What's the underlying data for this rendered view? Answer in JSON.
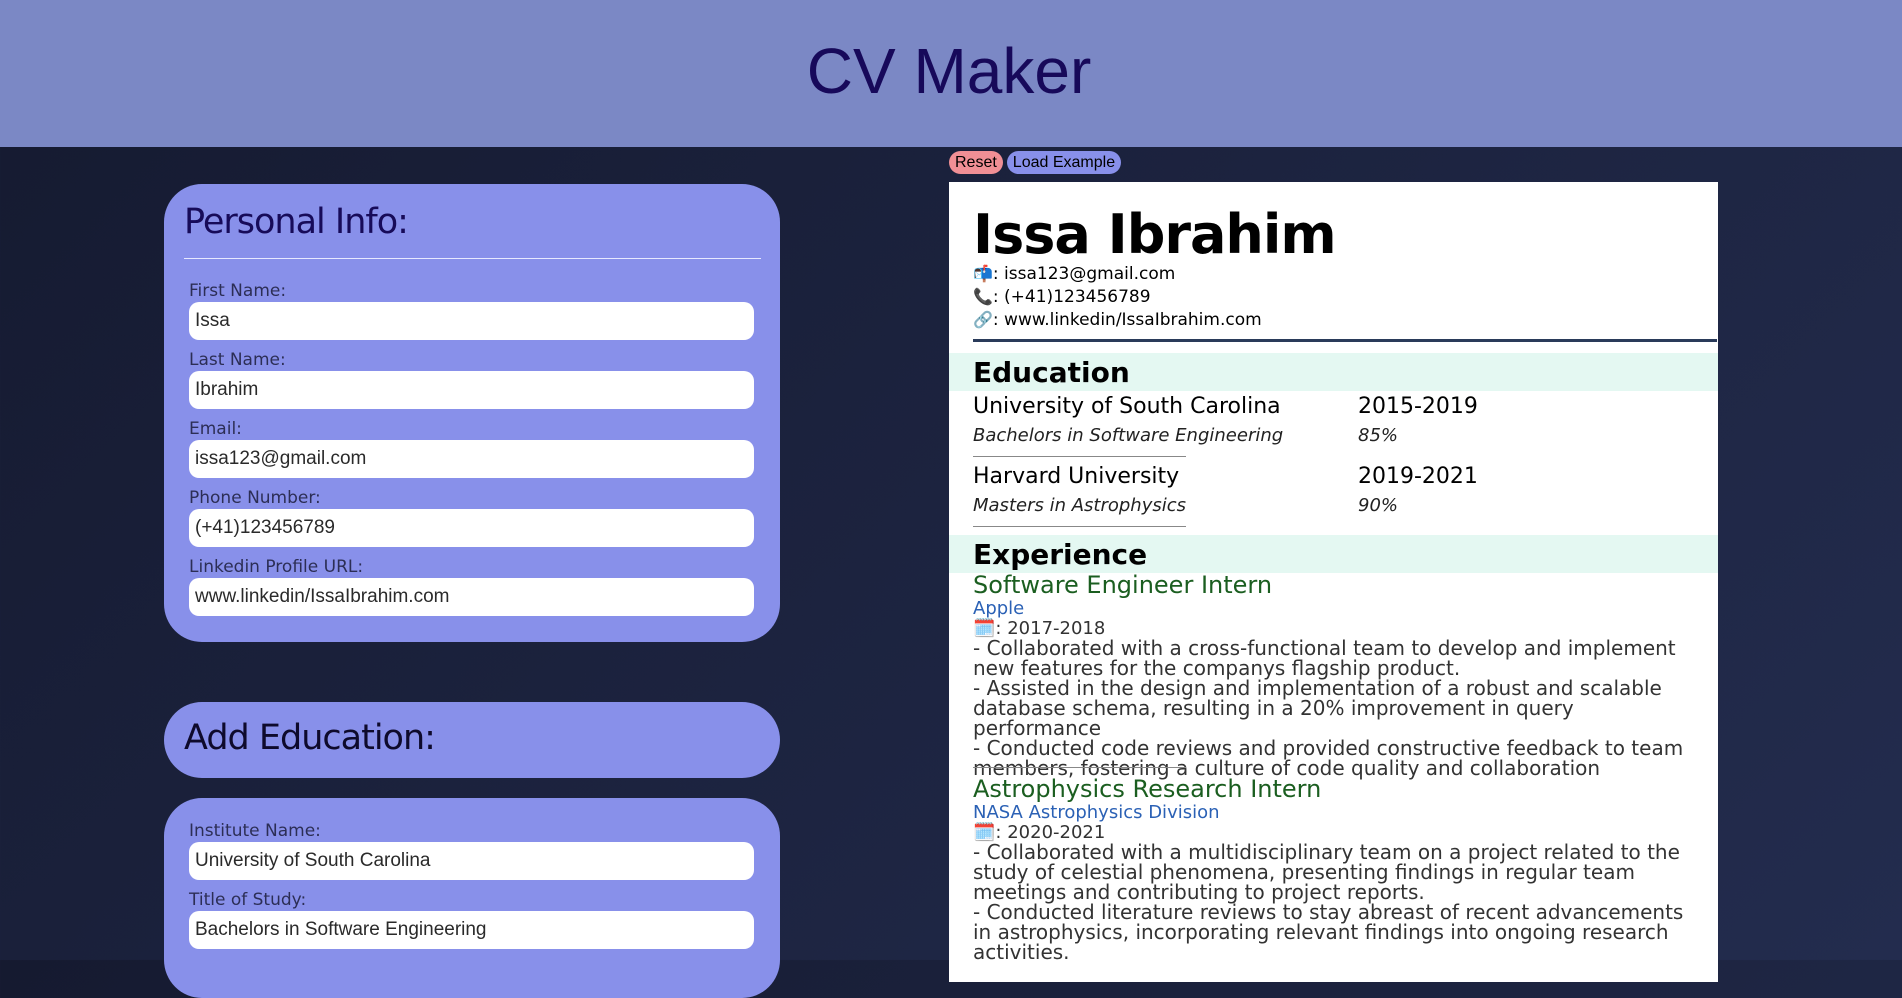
{
  "header": {
    "title": "CV Maker"
  },
  "personal": {
    "heading": "Personal Info:",
    "fields": [
      {
        "label": "First Name:",
        "value": "Issa"
      },
      {
        "label": "Last Name:",
        "value": "Ibrahim"
      },
      {
        "label": "Email:",
        "value": "issa123@gmail.com"
      },
      {
        "label": "Phone Number:",
        "value": "(+41)123456789"
      },
      {
        "label": "Linkedin Profile URL:",
        "value": "www.linkedin/IssaIbrahim.com"
      }
    ]
  },
  "add_education": {
    "heading": "Add Education:"
  },
  "education_form": {
    "fields": [
      {
        "label": "Institute Name:",
        "value": "University of South Carolina"
      },
      {
        "label": "Title of Study:",
        "value": "Bachelors in Software Engineering"
      }
    ]
  },
  "toolbar": {
    "reset_label": "Reset",
    "load_label": "Load Example"
  },
  "cv": {
    "name": "Issa Ibrahim",
    "contacts": [
      {
        "icon": "mailbox-icon",
        "glyph": "📬",
        "text": ": issa123@gmail.com"
      },
      {
        "icon": "phone-icon",
        "glyph": "📞",
        "text": ": (+41)123456789"
      },
      {
        "icon": "link-icon",
        "glyph": "🔗",
        "text": ": www.linkedin/IssaIbrahim.com"
      }
    ],
    "education_heading": "Education",
    "education": [
      {
        "institute": "University of South Carolina",
        "dates": "2015-2019",
        "title": "Bachelors in Software Engineering",
        "grade": "85%"
      },
      {
        "institute": "Harvard University",
        "dates": "2019-2021",
        "title": "Masters in Astrophysics",
        "grade": "90%"
      }
    ],
    "experience_heading": "Experience",
    "experience": [
      {
        "title": "Software Engineer Intern",
        "company": "Apple",
        "dates": ": 2017-2018",
        "bullets": [
          "- Collaborated with a cross-functional team to develop and implement new features for the companys flagship product.",
          "- Assisted in the design and implementation of a robust and scalable database schema, resulting in a 20% improvement in query performance",
          "- Conducted code reviews and provided constructive feedback to team members, fostering a culture of code quality and collaboration"
        ]
      },
      {
        "title": "Astrophysics Research Intern",
        "company": "NASA Astrophysics Division",
        "dates": ": 2020-2021",
        "bullets": [
          "- Collaborated with a multidisciplinary team on a project related to the study of celestial phenomena, presenting findings in regular team meetings and contributing to project reports.",
          "- Conducted literature reviews to stay abreast of recent advancements in astrophysics, incorporating relevant findings into ongoing research activities."
        ]
      }
    ]
  }
}
